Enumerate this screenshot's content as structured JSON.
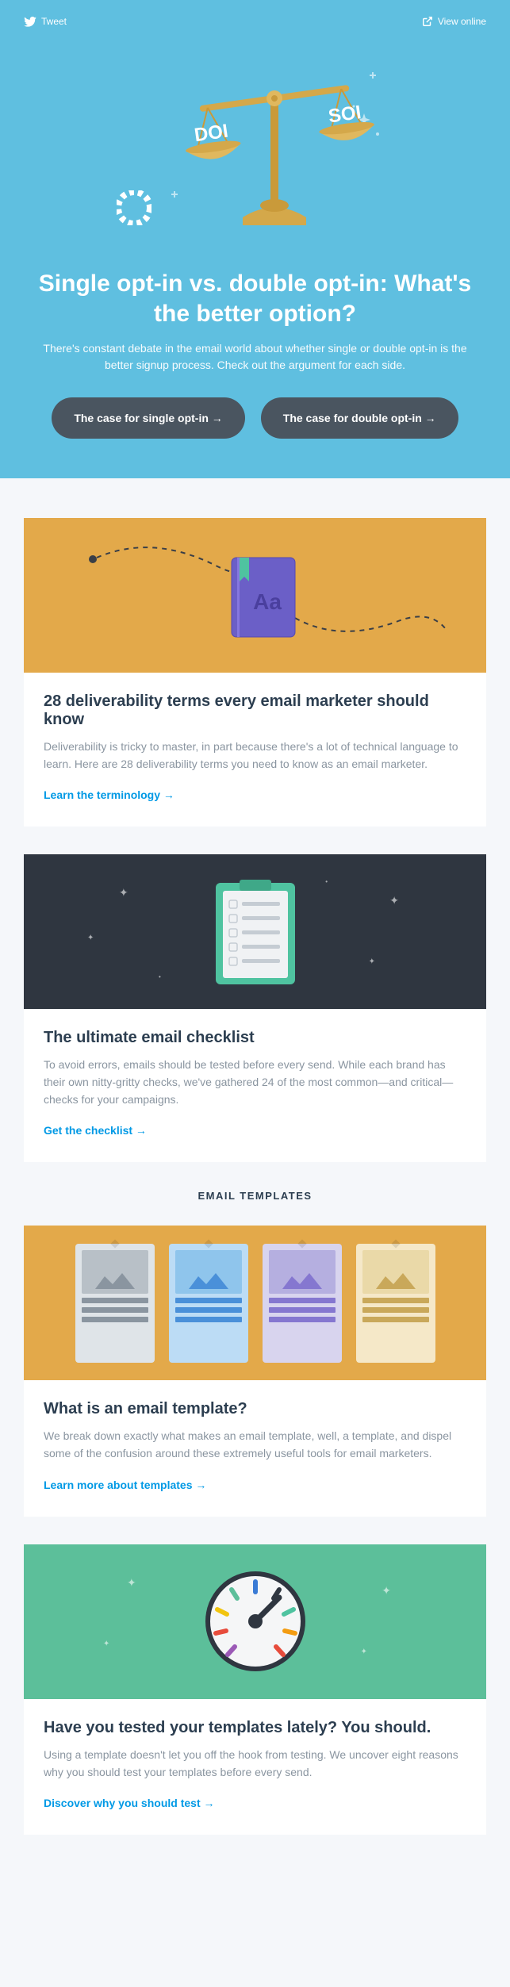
{
  "topbar": {
    "tweet": "Tweet",
    "view_online": "View online"
  },
  "hero": {
    "badge_left": "DOI",
    "badge_right": "SOI",
    "title": "Single opt-in vs. double opt-in: What's the better option?",
    "subtitle": "There's constant debate in the email world about whether single or double opt-in is the better signup process. Check out the argument for each side.",
    "btn_single": "The case for single opt-in →",
    "btn_double": "The case for double opt-in →"
  },
  "cards": [
    {
      "title": "28 deliverability terms every email marketer should know",
      "body": "Deliverability is tricky to master, in part because there's a lot of technical language to learn. Here are 28 deliverability terms you need to know as an email marketer.",
      "link": "Learn the terminology →"
    },
    {
      "title": "The ultimate email checklist",
      "body": "To avoid errors, emails should be tested before every send. While each brand has their own nitty-gritty checks, we've gathered 24 of the most common—and critical—checks for your campaigns.",
      "link": "Get the checklist →"
    }
  ],
  "templates_label": "EMAIL TEMPLATES",
  "templates_cards": [
    {
      "title": "What is an email template?",
      "body": "We break down exactly what makes an email template, well, a template, and dispel some of the confusion around these extremely useful tools for email marketers.",
      "link": "Learn more about templates →"
    },
    {
      "title": "Have you tested your templates lately? You should.",
      "body": "Using a template doesn't let you off the hook from testing. We uncover eight reasons why you should test your templates before every send.",
      "link": "Discover why you should test →"
    }
  ],
  "book_label": "Aa"
}
